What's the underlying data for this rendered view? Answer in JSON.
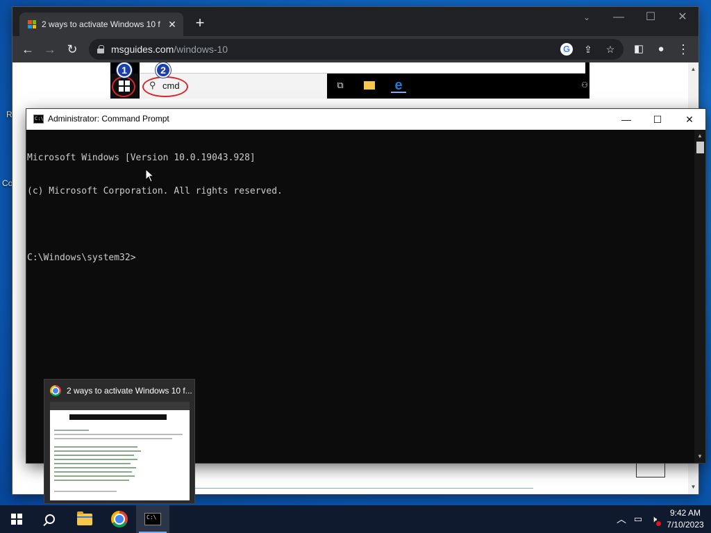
{
  "desktop": {
    "labels": [
      "R",
      "Co"
    ]
  },
  "browser": {
    "tab_title": "2 ways to activate Windows 10 f",
    "new_tab": "+",
    "url_host": "msguides.com",
    "url_path": "/windows-10",
    "page": {
      "search_text": "cmd",
      "badge_1": "1",
      "badge_2": "2"
    }
  },
  "cmd": {
    "title": "Administrator: Command Prompt",
    "lines": [
      "Microsoft Windows [Version 10.0.19043.928]",
      "(c) Microsoft Corporation. All rights reserved.",
      "",
      "C:\\Windows\\system32>"
    ]
  },
  "preview": {
    "title": "2 ways to activate Windows 10 f..."
  },
  "taskbar": {
    "time": "9:42 AM",
    "date": "7/10/2023"
  },
  "icons": {
    "start": "windows-logo-icon",
    "search": "search-icon",
    "explorer": "folder-icon",
    "chrome": "chrome-icon",
    "cmd": "command-prompt-icon"
  }
}
